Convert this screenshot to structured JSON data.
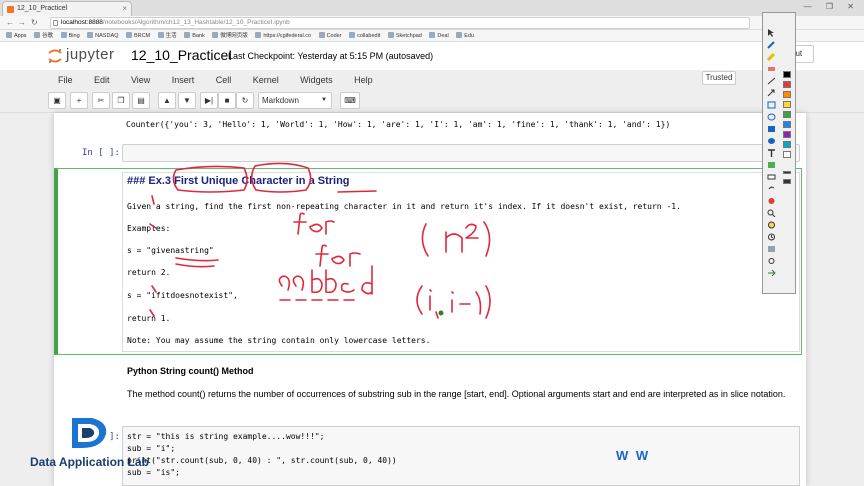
{
  "browser": {
    "tab_title": "12_10_Practicel",
    "url_host": "localhost:8888",
    "url_path": "/notebooks/Algorithm/ch12_13_Hashtable/12_10_PracticeI.ipynb",
    "window_controls": "— ❐ ✕",
    "bookmarks": [
      "Apps",
      "谷歌",
      "Bing",
      "NASDAQ",
      "BRCM",
      "生活",
      "Bank",
      "微博网页版",
      "https://cgifederal.co",
      "Coder",
      "collabedit",
      "Sketchpad",
      "Deal",
      "Edu"
    ]
  },
  "jupyter": {
    "logo_text": "jupyter",
    "notebook_title": "12_10_PracticeI",
    "checkpoint": "Last Checkpoint: Yesterday at 5:15 PM (autosaved)",
    "logout_label": "out",
    "trusted_label": "Trusted",
    "menu": [
      "File",
      "Edit",
      "View",
      "Insert",
      "Cell",
      "Kernel",
      "Widgets",
      "Help"
    ],
    "cell_type": "Markdown"
  },
  "cells": {
    "output_counter": "Counter({'you': 3, 'Hello': 1, 'World': 1, 'How': 1, 'are': 1, 'I': 1, 'am': 1, 'fine': 1, 'thank': 1, 'and': 1})",
    "empty_prompt": "In [ ]:",
    "md_heading": "### Ex.3 First Unique Character in a String",
    "md_lines": [
      "Given a string, find the first non-repeating character in it and return it's index. If it doesn't exist, return -1.",
      "Examples:",
      "s = \"givenastring\"",
      "return 2.",
      "s = \"ifitdoesnotexist\",",
      "return 1.",
      "Note: You may assume the string contain only lowercase letters."
    ],
    "section_title": "Python String count() Method",
    "section_body": "The method count() returns the number of occurrences of substring sub in the range [start, end]. Optional arguments start and end are interpreted as in slice notation.",
    "code_prompt": "In [ ]:",
    "code_lines": [
      "str = \"this is string example....wow!!!\";",
      "sub = \"i\";",
      "print(\"str.count(sub, 0, 40) : \", str.count(sub, 0, 40))",
      "sub = \"is\";"
    ]
  },
  "watermark": {
    "brand": "Data Application Lab",
    "corner": "W W"
  },
  "colors": {
    "accent_green": "#42a545",
    "prompt_blue": "#303f9f",
    "ink_red": "#e0283a",
    "jupyter_orange": "#f37626"
  }
}
